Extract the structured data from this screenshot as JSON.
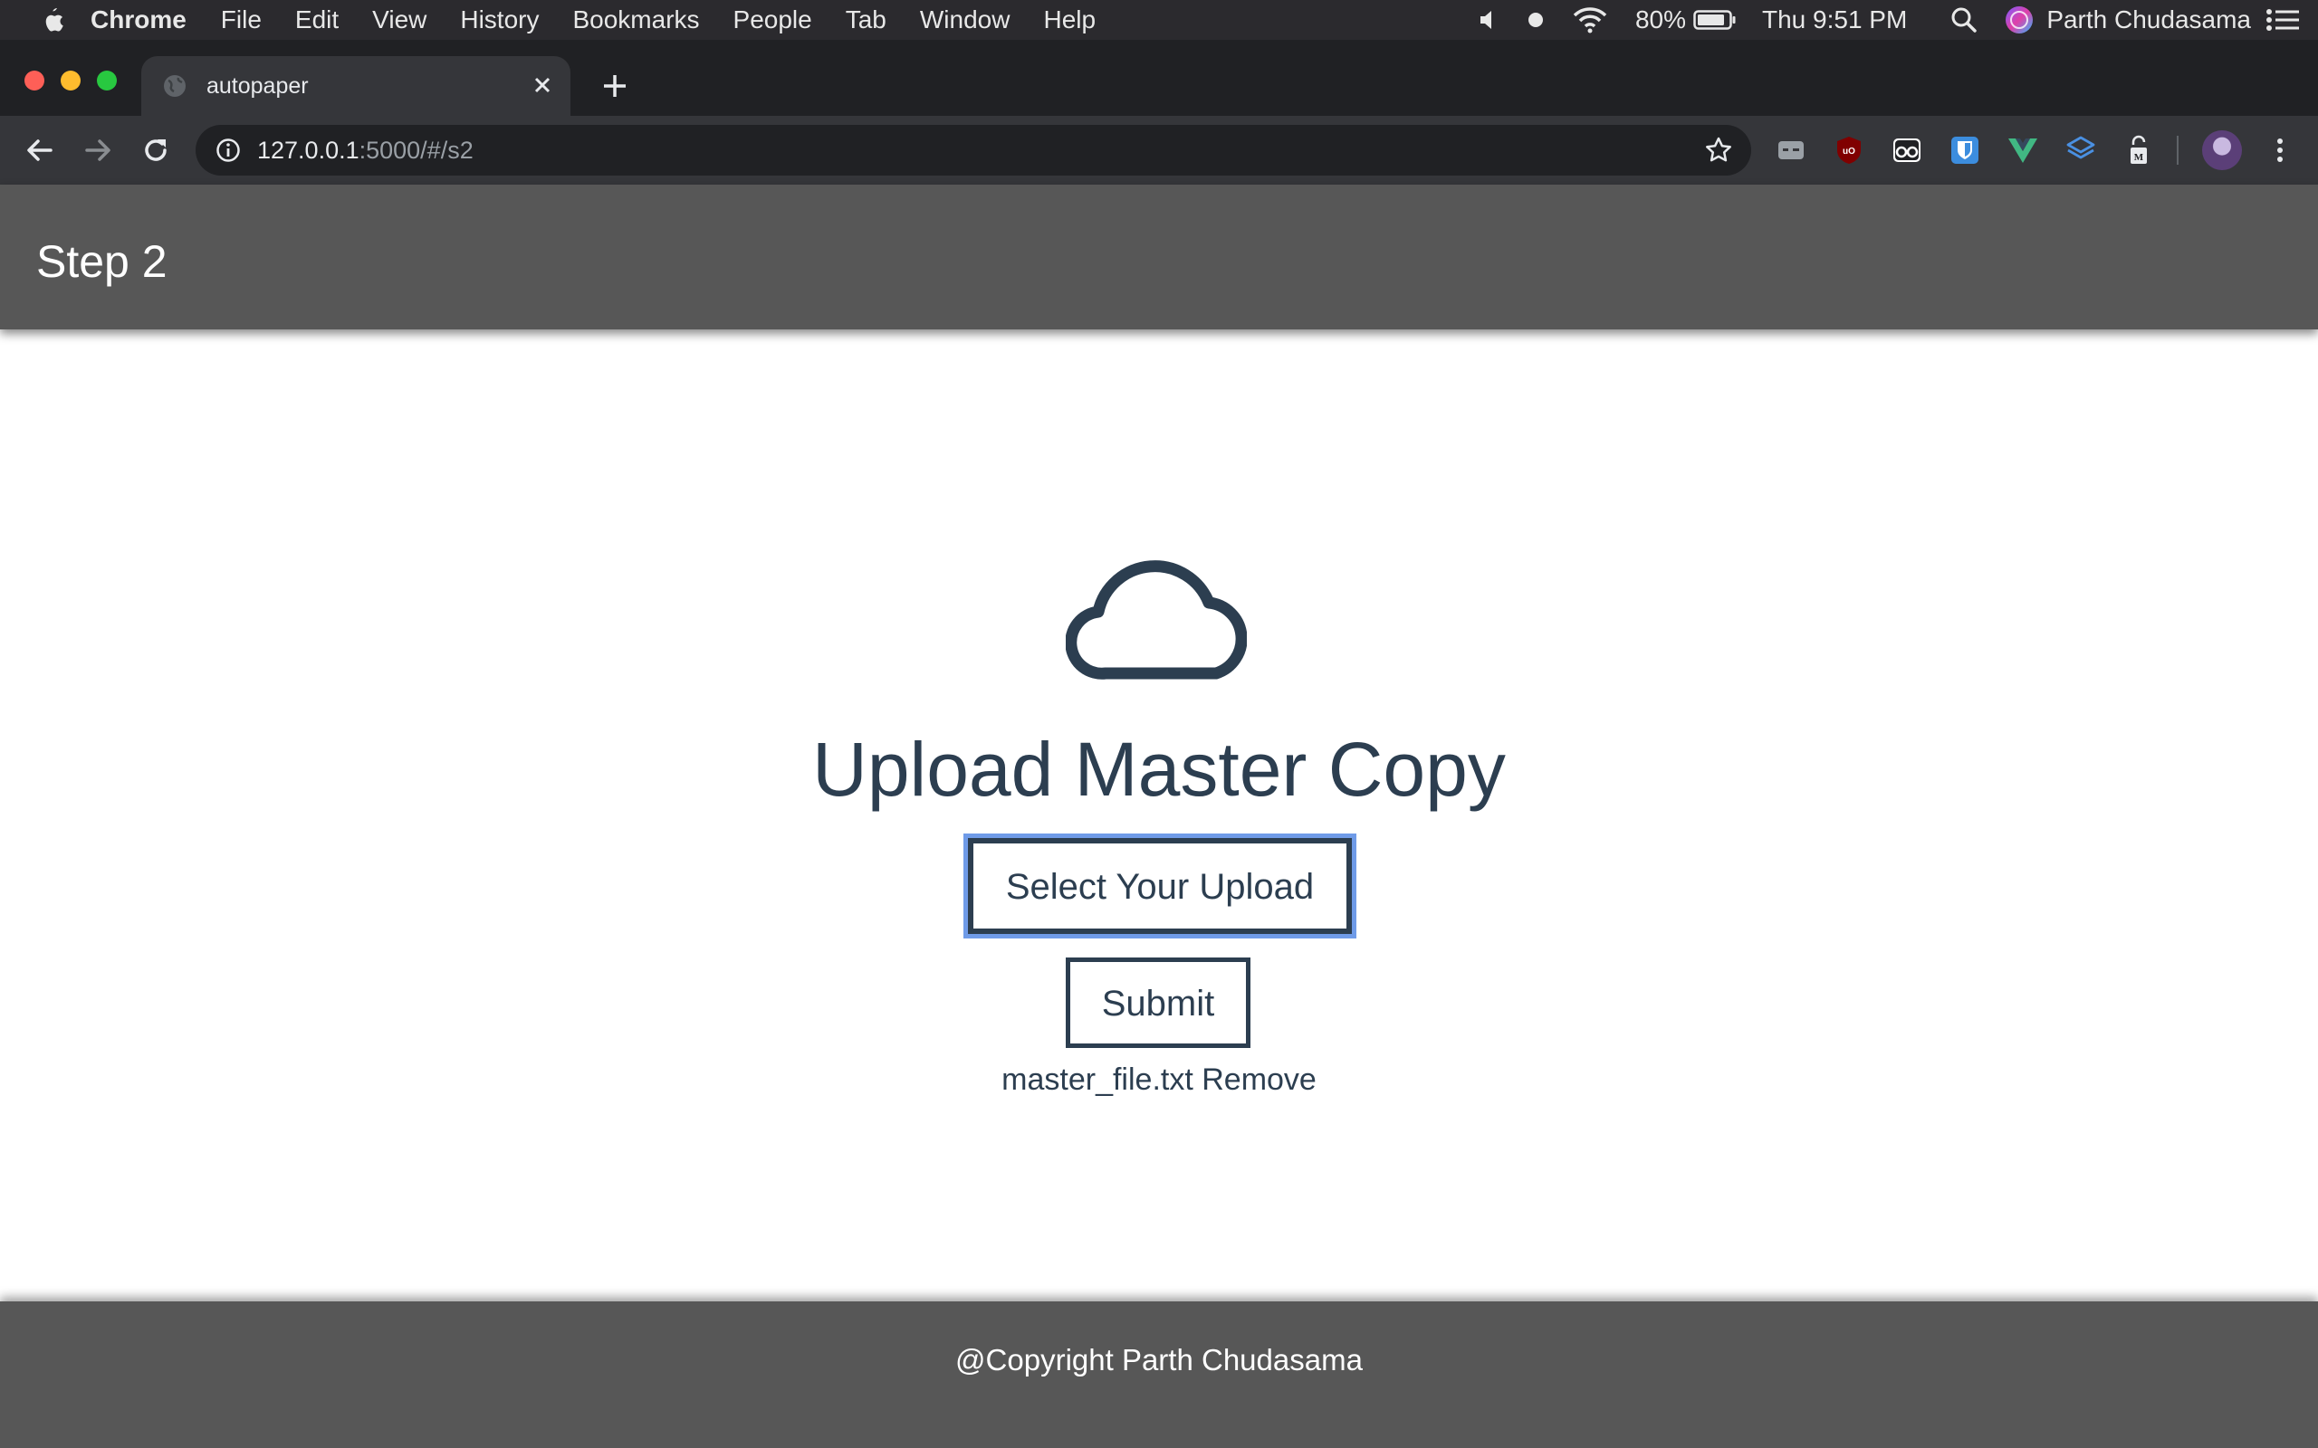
{
  "menubar": {
    "app": "Chrome",
    "items": [
      "File",
      "Edit",
      "View",
      "History",
      "Bookmarks",
      "People",
      "Tab",
      "Window",
      "Help"
    ],
    "battery": "80%",
    "clock": "Thu 9:51 PM",
    "user": "Parth Chudasama"
  },
  "browser": {
    "tab_title": "autopaper",
    "url_host": "127.0.0.1",
    "url_rest": ":5000/#/s2"
  },
  "header": {
    "title": "Step 2"
  },
  "main": {
    "headline": "Upload Master Copy",
    "select_button": "Select Your Upload",
    "submit_button": "Submit",
    "file_name": "master_file.txt",
    "remove_link": "Remove"
  },
  "footer": {
    "copyright": "@Copyright Parth Chudasama"
  },
  "icons": {
    "apple": "apple-icon",
    "volume": "speaker-icon",
    "record": "dot-icon",
    "wifi": "wifi-icon",
    "battery": "battery-icon",
    "search": "spotlight-icon",
    "siri": "siri-icon",
    "list": "control-center-icon",
    "cloud": "cloud-icon"
  },
  "colors": {
    "header_bg": "#575757",
    "text_primary": "#2c3e50",
    "focus_ring": "#6f9be8",
    "chrome_dark": "#202124",
    "chrome_toolbar": "#35363a"
  }
}
